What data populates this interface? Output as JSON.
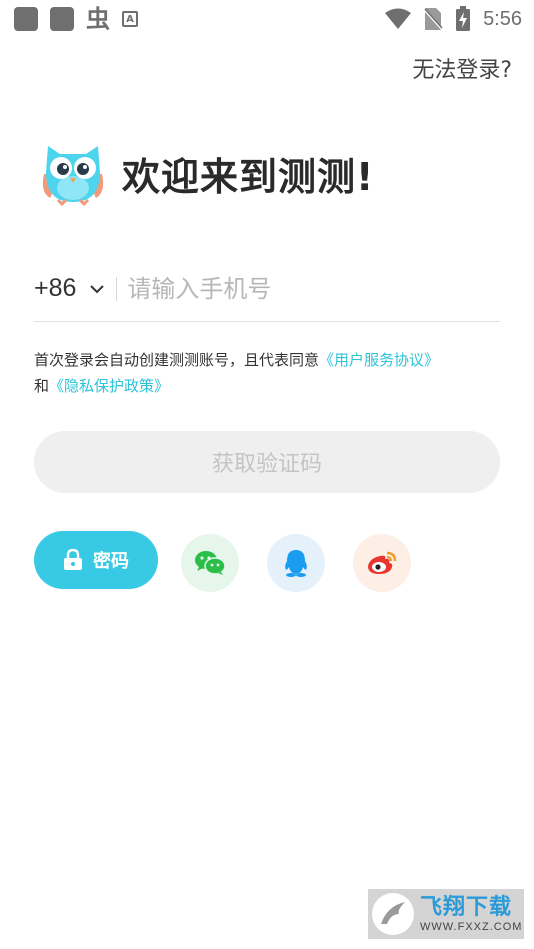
{
  "status_bar": {
    "time": "5:56",
    "glyph": "虫",
    "a_badge": "A"
  },
  "help_link": "无法登录?",
  "welcome": {
    "title": "欢迎来到测测!"
  },
  "phone": {
    "country_code": "+86",
    "placeholder": "请输入手机号"
  },
  "agreement": {
    "text": "首次登录会自动创建测测账号，且代表同意",
    "user_agreement": "《用户服务协议》",
    "and": "和",
    "privacy_policy": "《隐私保护政策》"
  },
  "code_button": "获取验证码",
  "password_button": "密码",
  "social": [
    "wechat-icon",
    "qq-icon",
    "weibo-icon"
  ],
  "colors": {
    "accent": "#38c9e4",
    "link": "#2cc2d9",
    "disabled_bg": "#efefef",
    "disabled_text": "#c4c4c4"
  },
  "watermark": {
    "title": "飞翔下载",
    "sub": "WWW.FXXZ.COM"
  }
}
